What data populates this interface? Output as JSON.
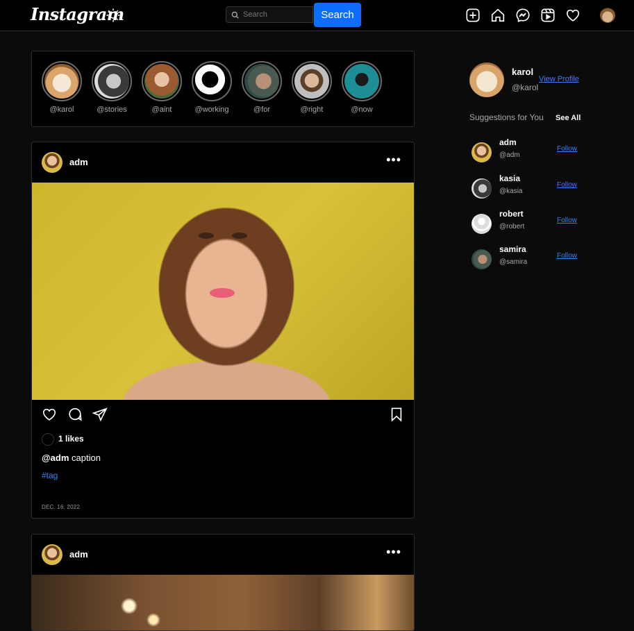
{
  "header": {
    "logo": "Instagram",
    "search_placeholder": "Search",
    "search_button": "Search",
    "icons": [
      "new-post-icon",
      "home-icon",
      "messenger-icon",
      "reels-icon",
      "heart-icon",
      "profile-avatar"
    ]
  },
  "stories": [
    {
      "handle": "@karol"
    },
    {
      "handle": "@stories"
    },
    {
      "handle": "@aint"
    },
    {
      "handle": "@working"
    },
    {
      "handle": "@for"
    },
    {
      "handle": "@right"
    },
    {
      "handle": "@now"
    }
  ],
  "posts": [
    {
      "user": "adm",
      "likes": "1 likes",
      "caption_user": "@adm",
      "caption_text": " caption",
      "tag": "#tag",
      "date": "DEC. 16, 2022"
    },
    {
      "user": "adm"
    }
  ],
  "sidebar": {
    "me": {
      "name": "karol",
      "handle": "@karol",
      "view_profile": "View Profile"
    },
    "suggestions_title": "Suggestions for You",
    "see_all": "See All",
    "suggestions": [
      {
        "name": "adm",
        "handle": "@adm",
        "action": "Follow"
      },
      {
        "name": "kasia",
        "handle": "@kasia",
        "action": "Follow"
      },
      {
        "name": "robert",
        "handle": "@robert",
        "action": "Follow"
      },
      {
        "name": "samira",
        "handle": "@samira",
        "action": "Follow"
      }
    ]
  },
  "colors": {
    "accent": "#0d6efd",
    "link": "#3b82f6",
    "background": "#0b0b0b"
  }
}
